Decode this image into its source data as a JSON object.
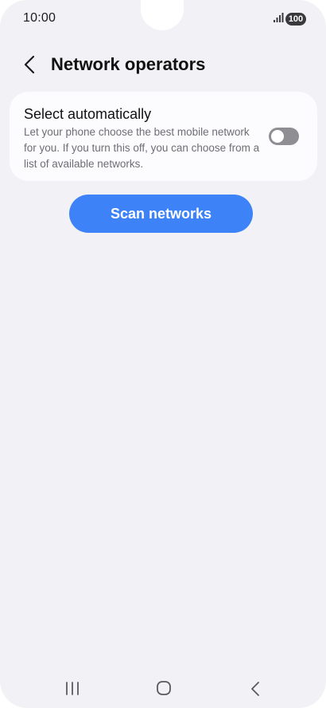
{
  "status_bar": {
    "time": "10:00",
    "battery": "100",
    "signal_icon": "signal-bars-icon"
  },
  "header": {
    "back_icon": "chevron-left-icon",
    "title": "Network operators"
  },
  "settings": {
    "select_automatically": {
      "title": "Select automatically",
      "description": "Let your phone choose the best mobile network for you. If you turn this off, you can choose from a list of available networks.",
      "enabled": false
    }
  },
  "actions": {
    "scan_label": "Scan networks"
  },
  "nav_bar": {
    "recents_icon": "recents-icon",
    "home_icon": "home-icon",
    "back_icon": "back-icon"
  },
  "colors": {
    "background": "#f2f2f6",
    "card": "#fcfcfe",
    "accent": "#3e82f7",
    "toggle_off": "#8e8e93"
  }
}
